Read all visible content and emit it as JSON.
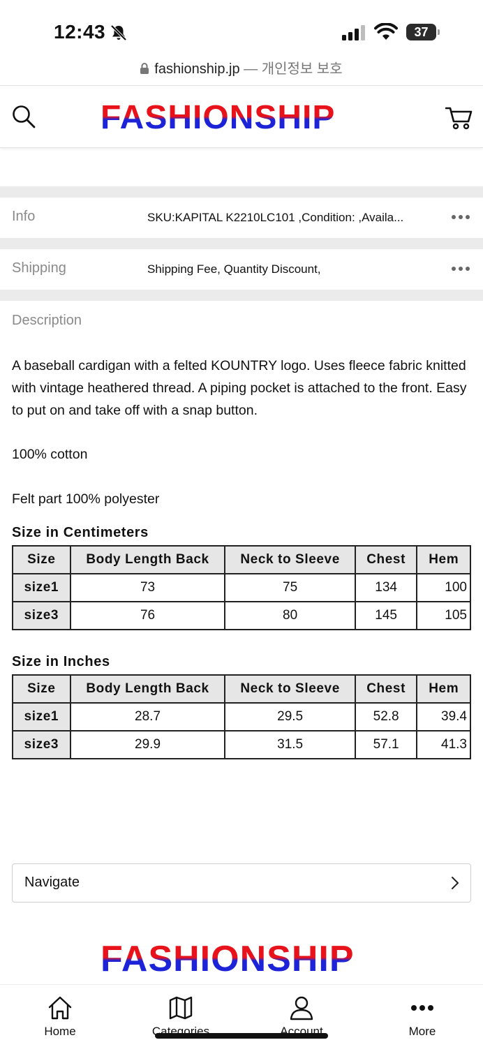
{
  "status_bar": {
    "time": "12:43",
    "battery": "37"
  },
  "url_bar": {
    "domain": "fashionship.jp",
    "separator": " — ",
    "privacy": "개인정보 보호"
  },
  "header": {
    "logo": "FASHIONSHIP"
  },
  "info_rows": [
    {
      "label": "Info",
      "value": "SKU:KAPITAL K2210LC101 ,Condition: ,Availa..."
    },
    {
      "label": "Shipping",
      "value": "Shipping Fee, Quantity Discount,"
    }
  ],
  "description": {
    "label": "Description",
    "text": "A baseball cardigan with a felted KOUNTRY logo. Uses fleece fabric knitted with vintage heathered thread. A piping pocket is attached to the front. Easy to put on and take off with a snap button.",
    "material": "100% cotton",
    "felt": "Felt part 100% polyester"
  },
  "size_cm": {
    "heading": "Size in Centimeters",
    "columns": [
      "Size",
      "Body Length Back",
      "Neck to Sleeve",
      "Chest",
      "Hem"
    ],
    "rows": [
      [
        "size1",
        "73",
        "75",
        "134",
        "100"
      ],
      [
        "size3",
        "76",
        "80",
        "145",
        "105"
      ]
    ]
  },
  "size_in": {
    "heading": "Size in Inches",
    "columns": [
      "Size",
      "Body Length Back",
      "Neck to Sleeve",
      "Chest",
      "Hem"
    ],
    "rows": [
      [
        "size1",
        "28.7",
        "29.5",
        "52.8",
        "39.4"
      ],
      [
        "size3",
        "29.9",
        "31.5",
        "57.1",
        "41.3"
      ]
    ]
  },
  "navigate": {
    "label": "Navigate"
  },
  "footer": {
    "logo": "FASHIONSHIP"
  },
  "bottom_nav": [
    {
      "label": "Home",
      "icon": "home-icon"
    },
    {
      "label": "Categories",
      "icon": "map-icon"
    },
    {
      "label": "Account",
      "icon": "user-icon"
    },
    {
      "label": "More",
      "icon": "more-icon"
    }
  ]
}
